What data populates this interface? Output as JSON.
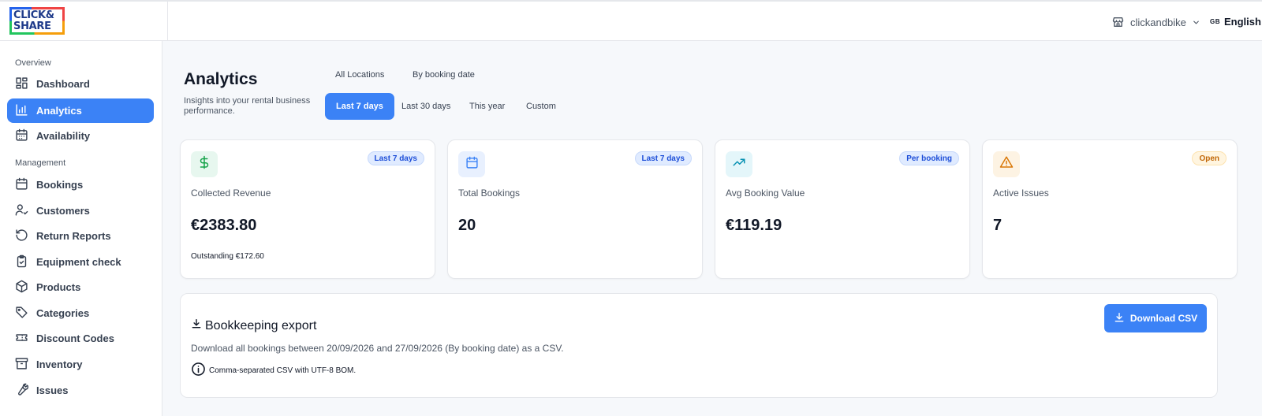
{
  "brand": {
    "logo_line1": "CLICK&",
    "logo_line2": "SHARE"
  },
  "header": {
    "store_name": "clickandbike",
    "language_flag": "GB",
    "language_label": "English"
  },
  "sidebar": {
    "sections": [
      {
        "label": "Overview"
      },
      {
        "label": "Management"
      }
    ],
    "items": [
      {
        "label": "Dashboard",
        "icon": "dashboard-grid-icon",
        "active": false
      },
      {
        "label": "Analytics",
        "icon": "bar-chart-icon",
        "active": true
      },
      {
        "label": "Availability",
        "icon": "calendar-grid-icon",
        "active": false
      },
      {
        "label": "Bookings",
        "icon": "calendar-icon",
        "active": false
      },
      {
        "label": "Customers",
        "icon": "user-check-icon",
        "active": false
      },
      {
        "label": "Return Reports",
        "icon": "rotate-icon",
        "active": false
      },
      {
        "label": "Equipment check",
        "icon": "clipboard-check-icon",
        "active": false
      },
      {
        "label": "Products",
        "icon": "package-icon",
        "active": false
      },
      {
        "label": "Categories",
        "icon": "tag-icon",
        "active": false
      },
      {
        "label": "Discount Codes",
        "icon": "ticket-icon",
        "active": false
      },
      {
        "label": "Inventory",
        "icon": "archive-icon",
        "active": false
      },
      {
        "label": "Issues",
        "icon": "wrench-icon",
        "active": false
      }
    ]
  },
  "page": {
    "title": "Analytics",
    "subtitle": "Insights into your rental business performance."
  },
  "filters": {
    "location": "All Locations",
    "date_basis": "By booking date",
    "ranges": [
      {
        "label": "Last 7 days",
        "active": true
      },
      {
        "label": "Last 30 days",
        "active": false
      },
      {
        "label": "This year",
        "active": false
      },
      {
        "label": "Custom",
        "active": false
      }
    ]
  },
  "cards": [
    {
      "label": "Collected Revenue",
      "value": "€2383.80",
      "badge": "Last 7 days",
      "badge_tone": "blue",
      "icon": "dollar-icon",
      "tile_color": "#e7f7ef",
      "icon_color": "#16a34a",
      "footnote": "Outstanding €172.60"
    },
    {
      "label": "Total Bookings",
      "value": "20",
      "badge": "Last 7 days",
      "badge_tone": "blue",
      "icon": "calendar-icon",
      "tile_color": "#e8f0fe",
      "icon_color": "#3b82f6",
      "footnote": ""
    },
    {
      "label": "Avg Booking Value",
      "value": "€119.19",
      "badge": "Per booking",
      "badge_tone": "blue",
      "icon": "trending-up-icon",
      "tile_color": "#e4f6fa",
      "icon_color": "#0891b2",
      "footnote": ""
    },
    {
      "label": "Active Issues",
      "value": "7",
      "badge": "Open",
      "badge_tone": "amber",
      "icon": "warning-icon",
      "tile_color": "#fdf3e3",
      "icon_color": "#d97706",
      "footnote": ""
    }
  ],
  "export": {
    "title": "Bookkeeping export",
    "description": "Download all bookings between 20/09/2026 and 27/09/2026 (By booking date) as a CSV.",
    "note": "Comma-separated CSV with UTF-8 BOM.",
    "button_label": "Download CSV"
  },
  "colors": {
    "accent": "#3b82f6",
    "text_primary": "#111827",
    "text_secondary": "#4b5563"
  }
}
